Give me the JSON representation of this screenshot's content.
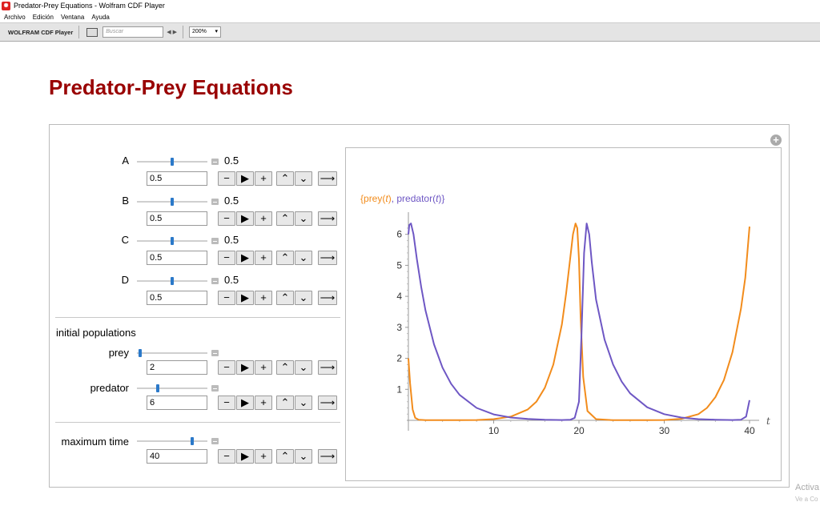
{
  "window": {
    "title": "Predator-Prey Equations - Wolfram CDF Player"
  },
  "menu": [
    "Archivo",
    "Edición",
    "Ventana",
    "Ayuda"
  ],
  "toolbar": {
    "brand": "WOLFRAM CDF Player",
    "search_placeholder": "Buscar",
    "zoom": "200%"
  },
  "page": {
    "title": "Predator-Prey Equations"
  },
  "controls": {
    "params": [
      {
        "label": "A",
        "value": "0.5",
        "input": "0.5",
        "level": 0.5
      },
      {
        "label": "B",
        "value": "0.5",
        "input": "0.5",
        "level": 0.5
      },
      {
        "label": "C",
        "value": "0.5",
        "input": "0.5",
        "level": 0.5
      },
      {
        "label": "D",
        "value": "0.5",
        "input": "0.5",
        "level": 0.5
      }
    ],
    "initial_section": "initial populations",
    "initial": [
      {
        "label": "prey",
        "input": "2",
        "level": 0.02
      },
      {
        "label": "predator",
        "input": "6",
        "level": 0.28
      }
    ],
    "time": {
      "label": "maximum time",
      "input": "40",
      "level": 0.8
    },
    "buttons": {
      "minus": "−",
      "play": "▶",
      "plus": "+",
      "faster": "⌃",
      "slower": "⌄",
      "direction": "⟶"
    }
  },
  "plot_label": {
    "open": "{",
    "prey": "prey(",
    "t1": "t",
    "close1": ")",
    "sep": ", ",
    "predator": "predator(",
    "t2": "t",
    "close2": ")",
    "end": "}"
  },
  "chart_data": {
    "type": "line",
    "x_axis_label": "t",
    "xlim": [
      0,
      40
    ],
    "ylim": [
      0,
      6.6
    ],
    "x_ticks": [
      10,
      20,
      30,
      40
    ],
    "y_ticks": [
      1,
      2,
      3,
      4,
      5,
      6
    ],
    "series": [
      {
        "name": "prey(t)",
        "color": "#f28c1c",
        "x": [
          0,
          0.2,
          0.5,
          0.8,
          1.2,
          2,
          4,
          6,
          8,
          10,
          12,
          14,
          15,
          16,
          17,
          18,
          18.5,
          19,
          19.3,
          19.6,
          19.8,
          20.0,
          20.2,
          20.5,
          21,
          22,
          24,
          28,
          30,
          32,
          34,
          35,
          36,
          37,
          38,
          39,
          39.5,
          40
        ],
        "y": [
          2,
          1.2,
          0.35,
          0.08,
          0.02,
          0.005,
          0.004,
          0.005,
          0.01,
          0.04,
          0.12,
          0.35,
          0.6,
          1.05,
          1.8,
          3.1,
          4.1,
          5.3,
          6.0,
          6.35,
          6.2,
          5.2,
          3.3,
          1.4,
          0.3,
          0.04,
          0.005,
          0.004,
          0.01,
          0.05,
          0.2,
          0.4,
          0.75,
          1.3,
          2.2,
          3.6,
          4.6,
          6.25
        ]
      },
      {
        "name": "predator(t)",
        "color": "#6e57c4",
        "x": [
          0,
          0.1,
          0.3,
          0.6,
          1,
          1.5,
          2,
          3,
          4,
          5,
          6,
          8,
          10,
          12,
          14,
          16,
          18,
          19,
          19.5,
          20,
          20.3,
          20.6,
          20.9,
          21.2,
          21.5,
          22,
          23,
          24,
          25,
          26,
          28,
          30,
          32,
          34,
          36,
          38,
          39,
          39.6,
          40
        ],
        "y": [
          6,
          6.3,
          6.35,
          6.0,
          5.2,
          4.3,
          3.55,
          2.45,
          1.7,
          1.18,
          0.82,
          0.4,
          0.19,
          0.09,
          0.045,
          0.02,
          0.01,
          0.02,
          0.08,
          0.6,
          2.8,
          5.4,
          6.35,
          6.0,
          5.1,
          3.9,
          2.6,
          1.8,
          1.25,
          0.87,
          0.42,
          0.2,
          0.09,
          0.04,
          0.02,
          0.01,
          0.02,
          0.12,
          0.65
        ]
      }
    ]
  },
  "watermark": {
    "line1": "Activa",
    "line2": "Ve a Co"
  }
}
